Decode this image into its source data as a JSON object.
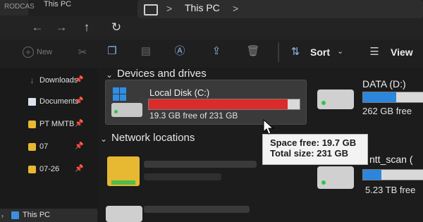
{
  "window": {
    "title": "This PC",
    "tab_fragment": "RODCAS"
  },
  "address": {
    "back_icon": "arrow-left-icon",
    "forward_icon": "arrow-right-icon",
    "up_icon": "arrow-up-icon",
    "refresh_icon": "refresh-icon",
    "breadcrumb": "This PC",
    "separator": ">"
  },
  "commandbar": {
    "new_label": "New",
    "sort_label": "Sort",
    "view_label": "View"
  },
  "sidebar": {
    "items": [
      {
        "label": "Downloads",
        "icon": "download-icon",
        "pinned": true
      },
      {
        "label": "Documents",
        "icon": "document-icon",
        "pinned": true
      },
      {
        "label": "PT MMTB",
        "icon": "folder-icon",
        "pinned": true
      },
      {
        "label": "07",
        "icon": "folder-icon",
        "pinned": true
      },
      {
        "label": "07-26",
        "icon": "folder-icon",
        "pinned": true
      },
      {
        "label": "This PC",
        "icon": "computer-icon",
        "pinned": false,
        "selected": true
      }
    ]
  },
  "main": {
    "devices_header": "Devices and drives",
    "network_header": "Network locations",
    "drives": [
      {
        "name": "Local Disk (C:)",
        "free_text": "19.3 GB free of 231 GB",
        "used_fraction": 0.92,
        "bar_color": "#dc2b2b"
      },
      {
        "name": "DATA (D:)",
        "free_text": "262 GB free",
        "used_fraction": 0.55,
        "bar_color": "#2b86dc"
      },
      {
        "name": "ntt_scan (",
        "free_text": "5.23 TB free",
        "used_fraction": 0.3,
        "bar_color": "#2b86dc"
      }
    ],
    "tooltip": {
      "space_free": "Space free: 19.7 GB",
      "total_size": "Total size: 231 GB"
    }
  }
}
